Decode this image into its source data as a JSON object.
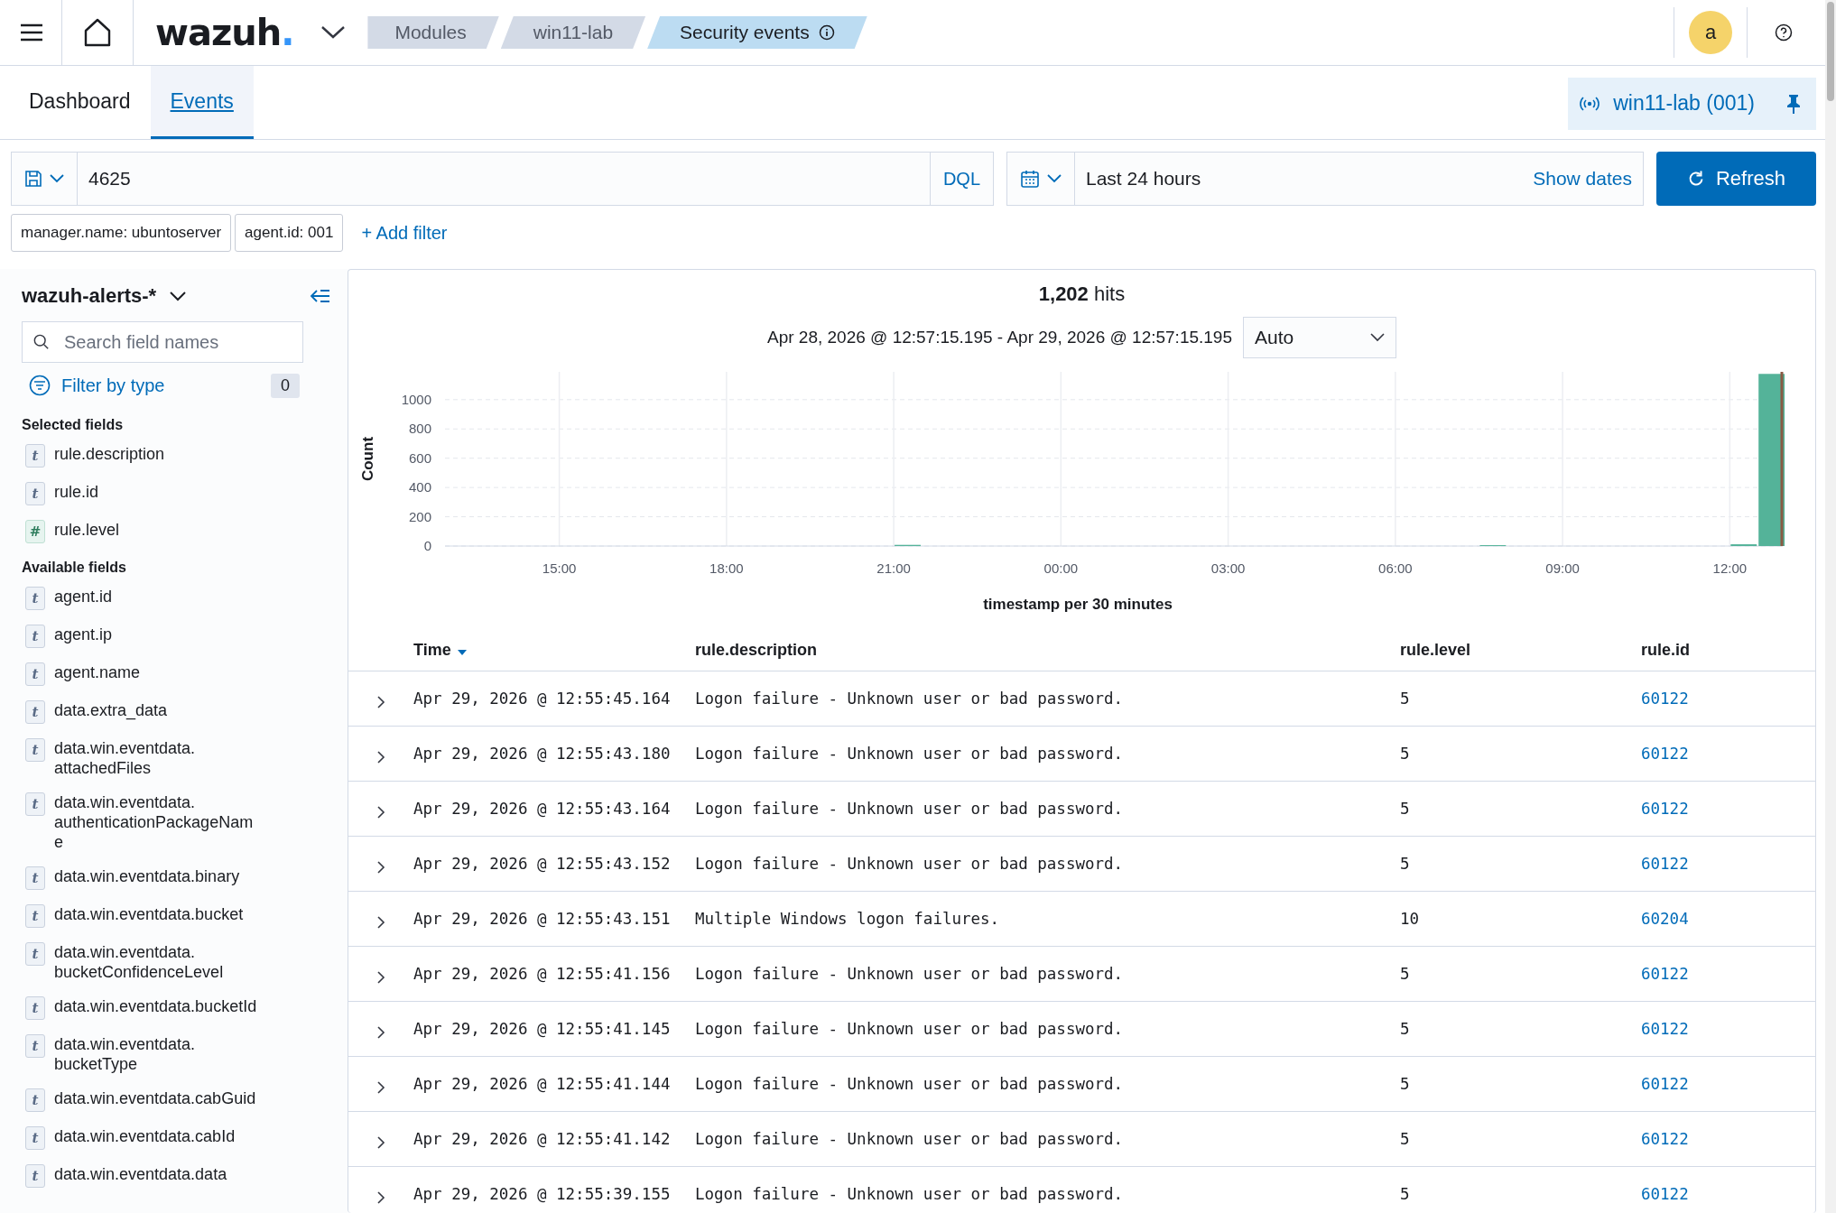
{
  "header": {
    "logo": {
      "text": "wazuh",
      "dot": "."
    },
    "breadcrumbs": [
      {
        "label": "Modules",
        "selected": false
      },
      {
        "label": "win11-lab",
        "selected": false
      },
      {
        "label": "Security events",
        "selected": true
      }
    ],
    "avatar": "a"
  },
  "tabs": [
    {
      "label": "Dashboard",
      "selected": false
    },
    {
      "label": "Events",
      "selected": true
    }
  ],
  "agent_pill": {
    "label": "win11-lab (001)"
  },
  "query": {
    "value": "4625",
    "language": "DQL",
    "time_range": "Last 24 hours",
    "show_dates": "Show dates",
    "refresh": "Refresh"
  },
  "filters": [
    {
      "label": "manager.name: ubuntoserver"
    },
    {
      "label": "agent.id: 001"
    }
  ],
  "add_filter": "+ Add filter",
  "sidebar": {
    "index_pattern": "wazuh-alerts-*",
    "search": {
      "placeholder": "Search field names"
    },
    "filter_by_type": "Filter by type",
    "filter_count": "0",
    "sections": [
      {
        "title": "Selected fields",
        "fields": [
          {
            "kind": "string",
            "badge": "t",
            "lines": [
              "rule.description"
            ]
          },
          {
            "kind": "string",
            "badge": "t",
            "lines": [
              "rule.id"
            ]
          },
          {
            "kind": "number",
            "badge": "#",
            "lines": [
              "rule.level"
            ]
          }
        ]
      },
      {
        "title": "Available fields",
        "fields": [
          {
            "kind": "string",
            "badge": "t",
            "lines": [
              "agent.id"
            ]
          },
          {
            "kind": "string",
            "badge": "t",
            "lines": [
              "agent.ip"
            ]
          },
          {
            "kind": "string",
            "badge": "t",
            "lines": [
              "agent.name"
            ]
          },
          {
            "kind": "string",
            "badge": "t",
            "lines": [
              "data.extra_data"
            ]
          },
          {
            "kind": "string",
            "badge": "t",
            "lines": [
              "data.win.eventdata.",
              "attachedFiles"
            ]
          },
          {
            "kind": "string",
            "badge": "t",
            "lines": [
              "data.win.eventdata.",
              "authenticationPackageNam",
              "e"
            ]
          },
          {
            "kind": "string",
            "badge": "t",
            "lines": [
              "data.win.eventdata.binary"
            ]
          },
          {
            "kind": "string",
            "badge": "t",
            "lines": [
              "data.win.eventdata.bucket"
            ]
          },
          {
            "kind": "string",
            "badge": "t",
            "lines": [
              "data.win.eventdata.",
              "bucketConfidenceLevel"
            ]
          },
          {
            "kind": "string",
            "badge": "t",
            "lines": [
              "data.win.eventdata.bucketId"
            ]
          },
          {
            "kind": "string",
            "badge": "t",
            "lines": [
              "data.win.eventdata.",
              "bucketType"
            ]
          },
          {
            "kind": "string",
            "badge": "t",
            "lines": [
              "data.win.eventdata.cabGuid"
            ]
          },
          {
            "kind": "string",
            "badge": "t",
            "lines": [
              "data.win.eventdata.cabId"
            ]
          },
          {
            "kind": "string",
            "badge": "t",
            "lines": [
              "data.win.eventdata.data"
            ]
          }
        ]
      }
    ]
  },
  "results": {
    "hits_count": "1,202",
    "hits_label": "hits",
    "date_range": "Apr 28, 2026 @ 12:57:15.195 - Apr 29, 2026 @ 12:57:15.195",
    "interval": "Auto",
    "chart_data": {
      "type": "bar",
      "xlabel": "timestamp per 30 minutes",
      "ylabel": "Count",
      "x": [
        "2026-04-28 21:15",
        "2026-04-29 07:45",
        "2026-04-29 12:15",
        "2026-04-29 12:45"
      ],
      "series": [
        {
          "color": "#54b399",
          "values": [
            8,
            6,
            12,
            1176
          ]
        }
      ],
      "xlim": [
        "2026-04-28 12:57",
        "2026-04-29 12:57"
      ],
      "ylim": [
        0,
        1190
      ],
      "xticks": [
        {
          "value": "2026-04-28 15:00",
          "label": "15:00"
        },
        {
          "value": "2026-04-28 18:00",
          "label": "18:00"
        },
        {
          "value": "2026-04-28 21:00",
          "label": "21:00"
        },
        {
          "value": "2026-04-29 00:00",
          "label": "00:00"
        },
        {
          "value": "2026-04-29 03:00",
          "label": "03:00"
        },
        {
          "value": "2026-04-29 06:00",
          "label": "06:00"
        },
        {
          "value": "2026-04-29 09:00",
          "label": "09:00"
        },
        {
          "value": "2026-04-29 12:00",
          "label": "12:00"
        }
      ],
      "yticks": [
        0,
        200,
        400,
        600,
        800,
        1000
      ],
      "grid": true,
      "ref_lines": [
        {
          "axis": "x",
          "value": "2026-04-29 12:57",
          "color": "#8a5a44"
        }
      ]
    }
  },
  "table": {
    "columns": [
      "Time",
      "rule.description",
      "rule.level",
      "rule.id"
    ],
    "rows": [
      {
        "time": "Apr 29, 2026 @ 12:55:45.164",
        "description": "Logon failure - Unknown user or bad password.",
        "level": "5",
        "id": "60122"
      },
      {
        "time": "Apr 29, 2026 @ 12:55:43.180",
        "description": "Logon failure - Unknown user or bad password.",
        "level": "5",
        "id": "60122"
      },
      {
        "time": "Apr 29, 2026 @ 12:55:43.164",
        "description": "Logon failure - Unknown user or bad password.",
        "level": "5",
        "id": "60122"
      },
      {
        "time": "Apr 29, 2026 @ 12:55:43.152",
        "description": "Logon failure - Unknown user or bad password.",
        "level": "5",
        "id": "60122"
      },
      {
        "time": "Apr 29, 2026 @ 12:55:43.151",
        "description": "Multiple Windows logon failures.",
        "level": "10",
        "id": "60204"
      },
      {
        "time": "Apr 29, 2026 @ 12:55:41.156",
        "description": "Logon failure - Unknown user or bad password.",
        "level": "5",
        "id": "60122"
      },
      {
        "time": "Apr 29, 2026 @ 12:55:41.145",
        "description": "Logon failure - Unknown user or bad password.",
        "level": "5",
        "id": "60122"
      },
      {
        "time": "Apr 29, 2026 @ 12:55:41.144",
        "description": "Logon failure - Unknown user or bad password.",
        "level": "5",
        "id": "60122"
      },
      {
        "time": "Apr 29, 2026 @ 12:55:41.142",
        "description": "Logon failure - Unknown user or bad password.",
        "level": "5",
        "id": "60122"
      },
      {
        "time": "Apr 29, 2026 @ 12:55:39.155",
        "description": "Logon failure - Unknown user or bad password.",
        "level": "5",
        "id": "60122"
      }
    ]
  }
}
